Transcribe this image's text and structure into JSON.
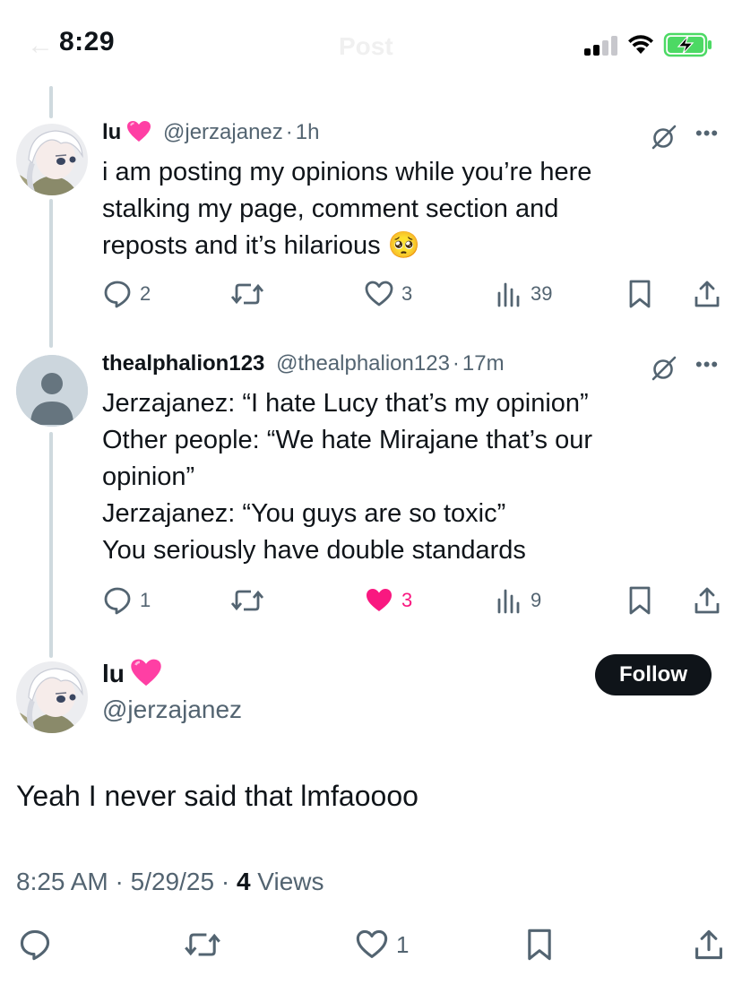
{
  "status_bar": {
    "time": "8:29",
    "battery_state": "charging",
    "accent": "#4cd964"
  },
  "header": {
    "title": "Post"
  },
  "thread": [
    {
      "name": "lu",
      "name_emoji": "pink-heart",
      "handle": "@jerzajanez",
      "time": "1h",
      "separator": "·",
      "text_lines": [
        "i am posting my opinions while you’re here",
        "stalking my page, comment section and",
        "reposts and it’s hilarious 🥺"
      ],
      "replies": "2",
      "reposts": "",
      "likes": "3",
      "views": "39",
      "liked": false
    },
    {
      "name": "thealphalion123",
      "handle": "@thealphalion123",
      "time": "17m",
      "separator": "·",
      "text_lines": [
        "Jerzajanez: “I hate Lucy that’s my opinion”",
        "Other people: “We hate Mirajane that’s our",
        "opinion”",
        "Jerzajanez: “You guys are so toxic”",
        "You seriously have double standards"
      ],
      "replies": "1",
      "reposts": "",
      "likes": "3",
      "views": "9",
      "liked": true
    }
  ],
  "main_post": {
    "name": "lu",
    "name_emoji": "pink-heart",
    "handle": "@jerzajanez",
    "follow_label": "Follow",
    "text": "Yeah I never said that lmfaoooo",
    "time": "8:25 AM",
    "date": "5/29/25",
    "separator": "·",
    "views_count": "4",
    "views_label": "Views",
    "replies": "",
    "reposts": "",
    "likes": "1"
  },
  "colors": {
    "text": "#0f1419",
    "secondary": "#536471",
    "like": "#f91880",
    "thread_line": "#cfd9de"
  }
}
